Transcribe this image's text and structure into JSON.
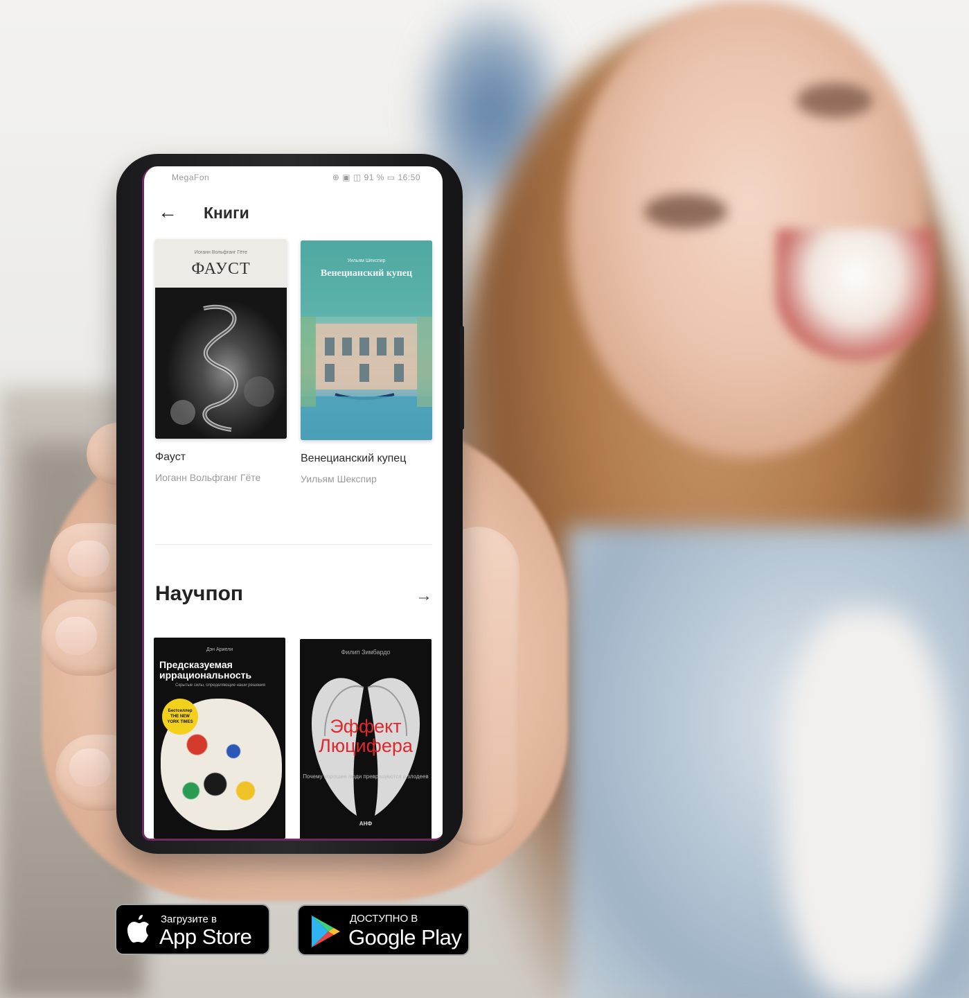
{
  "status_bar": {
    "carrier": "MegaFon",
    "indicators": "⊕ ▣ ◫ 91 %",
    "time": "16:50"
  },
  "header": {
    "back_icon": "arrow-left-icon",
    "title": "Книги"
  },
  "books_section": {
    "items": [
      {
        "title": "Фауст",
        "author": "Иоганн Вольфганг Гёте",
        "cover_top_text": "Иоганн Вольфганг Гёте",
        "cover_title": "ФАУСТ"
      },
      {
        "title": "Венецианский купец",
        "author": "Уильям Шекспир",
        "cover_top_text": "Уильям Шекспир",
        "cover_title": "Венецианский купец"
      }
    ]
  },
  "popsci_section": {
    "title": "Научпоп",
    "arrow_icon": "arrow-right-icon",
    "items": [
      {
        "cover_author": "Дэн Ариели",
        "cover_title": "Предсказуемая иррациональность",
        "cover_subtitle": "Скрытые силы, определяющие наши решения",
        "badge": "Бестселлер THE NEW YORK TIMES"
      },
      {
        "cover_author": "Филип Зимбардо",
        "cover_title": "Эффект Люцифера",
        "cover_subtitle": "Почему хорошие люди превращаются в злодеев",
        "publisher": "АНФ"
      }
    ]
  },
  "store_badges": {
    "app_store": {
      "small": "Загрузите в",
      "big": "App Store"
    },
    "google_play": {
      "small": "ДОСТУПНО В",
      "big": "Google Play"
    }
  },
  "colors": {
    "screen_accent": "#6f2a5f",
    "merchant_cover": "#5eb0a9",
    "lucifer_red": "#e0282c"
  }
}
